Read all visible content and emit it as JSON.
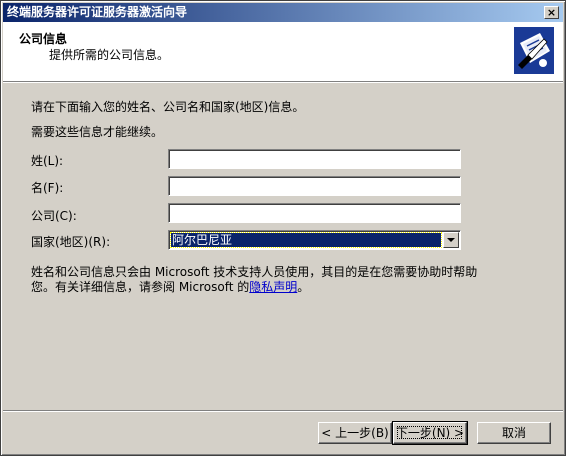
{
  "window": {
    "title": "终端服务器许可证服务器激活向导",
    "close_glyph": "×"
  },
  "header": {
    "title": "公司信息",
    "subtitle": "提供所需的公司信息。",
    "icon": "wizard-banner-icon"
  },
  "intro": {
    "line1": "请在下面输入您的姓名、公司名和国家(地区)信息。",
    "line2": "需要这些信息才能继续。"
  },
  "form": {
    "last_name_label": "姓(L):",
    "last_name_value": "",
    "first_name_label": "名(F):",
    "first_name_value": "",
    "company_label": "公司(C):",
    "company_value": "",
    "country_label": "国家(地区)(R):",
    "country_value": "阿尔巴尼亚"
  },
  "note": {
    "text": "姓名和公司信息只会由 Microsoft 技术支持人员使用，其目的是在您需要协助时帮助您。有关详细信息，请参阅 Microsoft 的",
    "link": "隐私声明",
    "end": "。"
  },
  "buttons": {
    "back": "< 上一步(B)",
    "next": "下一步(N) >",
    "cancel": "取消"
  },
  "colors": {
    "title_gradient_start": "#0a246a",
    "title_gradient_end": "#a6caf0",
    "face": "#d4d0c8",
    "selection": "#0a246a"
  }
}
